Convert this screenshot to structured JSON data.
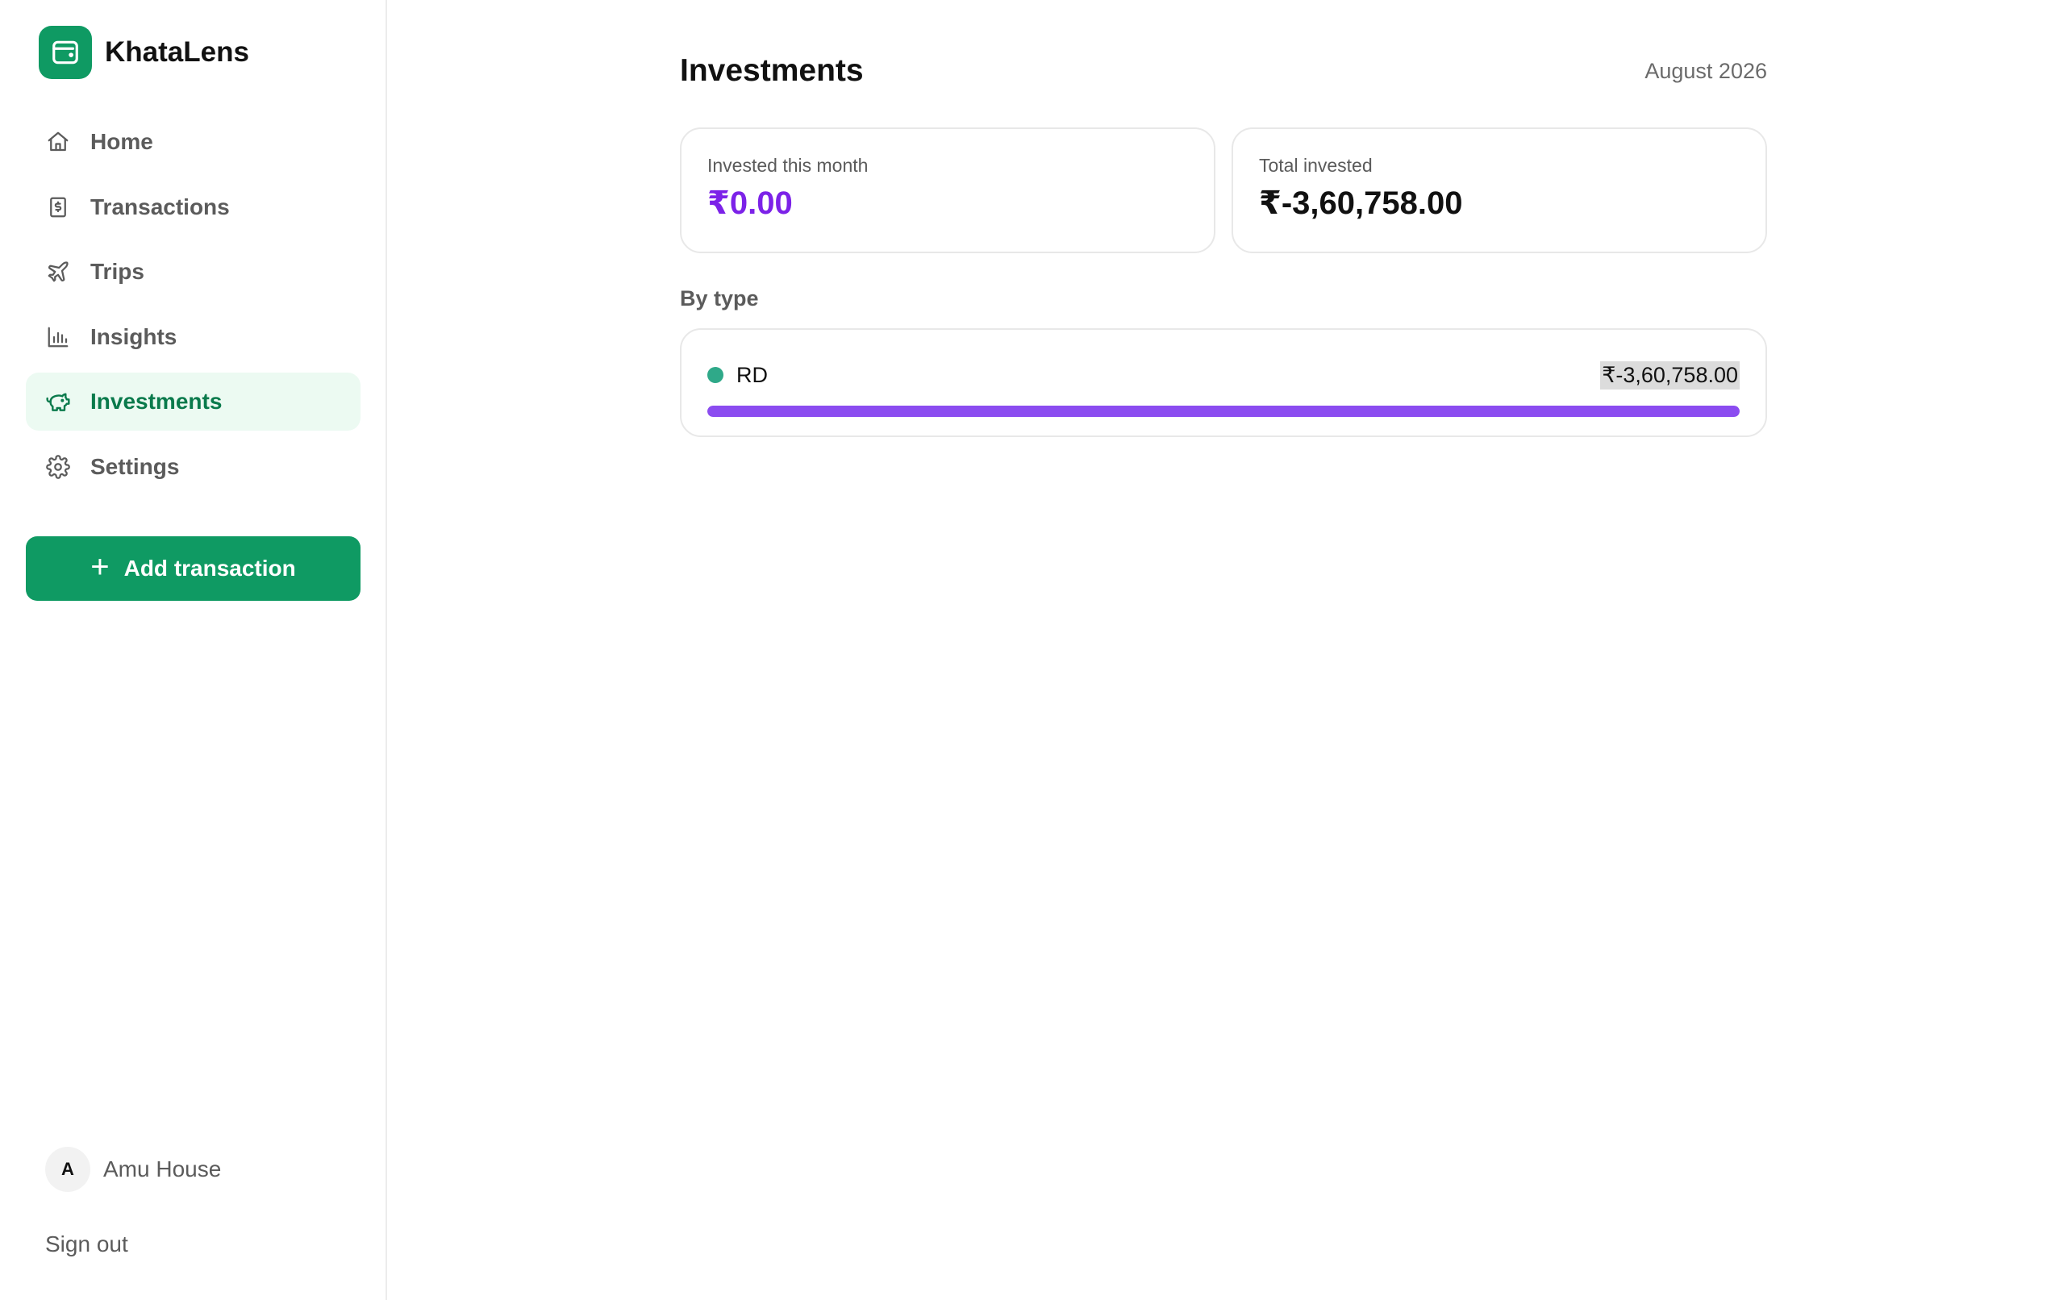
{
  "brand": {
    "name": "KhataLens",
    "logo_icon": "wallet-icon",
    "color": "#0f9a63"
  },
  "nav": {
    "items": [
      {
        "label": "Home",
        "icon": "home-icon",
        "active": false
      },
      {
        "label": "Transactions",
        "icon": "receipt-icon",
        "active": false
      },
      {
        "label": "Trips",
        "icon": "plane-icon",
        "active": false
      },
      {
        "label": "Insights",
        "icon": "bar-chart-icon",
        "active": false
      },
      {
        "label": "Investments",
        "icon": "piggy-bank-icon",
        "active": true
      },
      {
        "label": "Settings",
        "icon": "gear-icon",
        "active": false
      }
    ],
    "active_bg": "#ecfaf2",
    "active_color": "#0a7a4c"
  },
  "add_button": {
    "label": "Add transaction",
    "icon": "plus-icon"
  },
  "user": {
    "initial": "A",
    "name": "Amu House"
  },
  "signout_label": "Sign out",
  "header": {
    "title": "Investments",
    "period": "August 2026"
  },
  "cards": [
    {
      "label": "Invested this month",
      "value": "₹0.00",
      "color": "#7c22e8"
    },
    {
      "label": "Total invested",
      "value": "₹-3,60,758.00",
      "color": "#111111"
    }
  ],
  "by_type": {
    "title": "By type",
    "items": [
      {
        "name": "RD",
        "amount": "₹-3,60,758.00",
        "dot_color": "#2fa989",
        "bar_color": "#8b4cf0",
        "share": 1.0
      }
    ]
  }
}
